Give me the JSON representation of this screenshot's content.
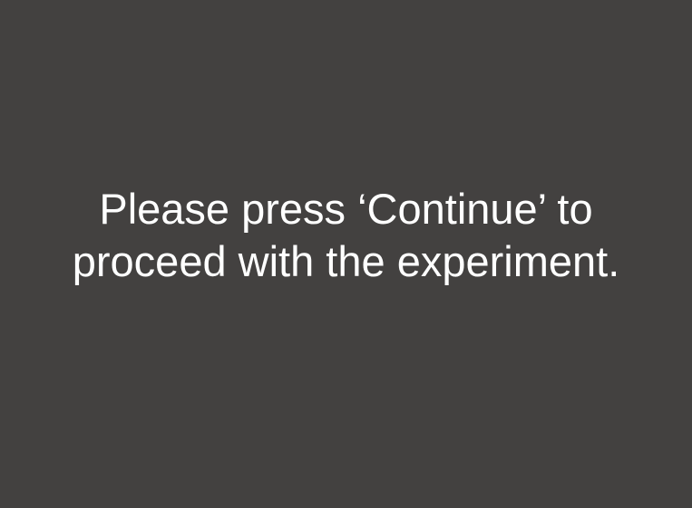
{
  "screen": {
    "background_color": "#434140",
    "text_color": "#ffffff"
  },
  "instruction": {
    "line1": "Please press ‘Continue’ to",
    "line2": "proceed with the experiment."
  }
}
